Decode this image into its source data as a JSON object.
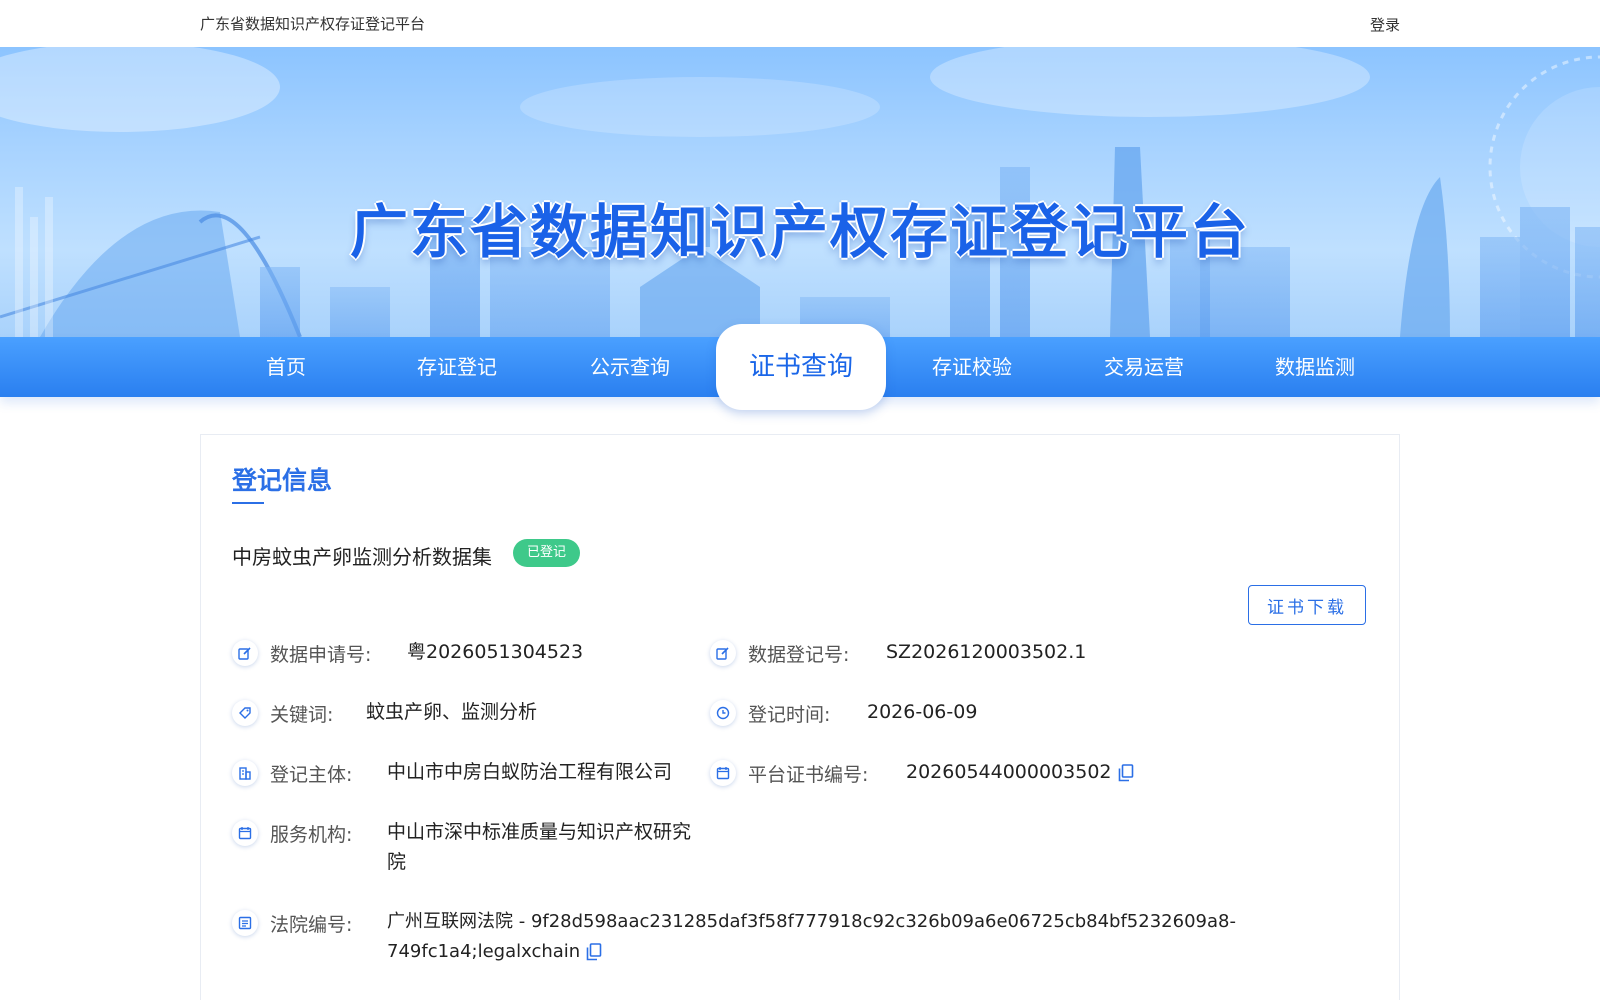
{
  "topbar": {
    "site_name": "广东省数据知识产权存证登记平台",
    "login": "登录"
  },
  "banner": {
    "title": "广东省数据知识产权存证登记平台"
  },
  "nav": {
    "items": [
      {
        "label": "首页"
      },
      {
        "label": "存证登记"
      },
      {
        "label": "公示查询"
      },
      {
        "label": "证书查询"
      },
      {
        "label": "存证校验"
      },
      {
        "label": "交易运营"
      },
      {
        "label": "数据监测"
      }
    ],
    "active_index": 3
  },
  "card": {
    "section_title": "登记信息",
    "dataset_name": "中房蚊虫产卵监测分析数据集",
    "status": "已登记",
    "download_label": "证书下载",
    "fields": {
      "application_no": {
        "label": "数据申请号:",
        "value": "粤2026051304523",
        "icon": "edit-icon"
      },
      "registration_no": {
        "label": "数据登记号:",
        "value": "SZ2026120003502.1",
        "icon": "edit-icon"
      },
      "keywords": {
        "label": "关键词:",
        "value": "蚊虫产卵、监测分析",
        "icon": "tag-icon"
      },
      "registration_time": {
        "label": "登记时间:",
        "value": "2026-06-09",
        "icon": "clock-icon"
      },
      "subject": {
        "label": "登记主体:",
        "value": "中山市中房白蚁防治工程有限公司",
        "icon": "building-icon"
      },
      "platform_cert_no": {
        "label": "平台证书编号:",
        "value": "20260544000003502",
        "icon": "calendar-icon"
      },
      "service_org": {
        "label": "服务机构:",
        "value_line1": "中山市深中标准质量与知识产权研究",
        "value_line2": "院",
        "icon": "calendar-icon"
      },
      "court_no": {
        "label": "法院编号:",
        "value_line1": "广州互联网法院 - 9f28d598aac231285daf3f58f777918c92c326b09a6e06725cb84bf5232609a8-",
        "value_line2": "749fc1a4;legalxchain",
        "icon": "document-icon"
      }
    }
  },
  "colors": {
    "brand": "#2b6fe6",
    "nav_bg": "#3a8ff8",
    "status_green": "#3ec98a"
  }
}
